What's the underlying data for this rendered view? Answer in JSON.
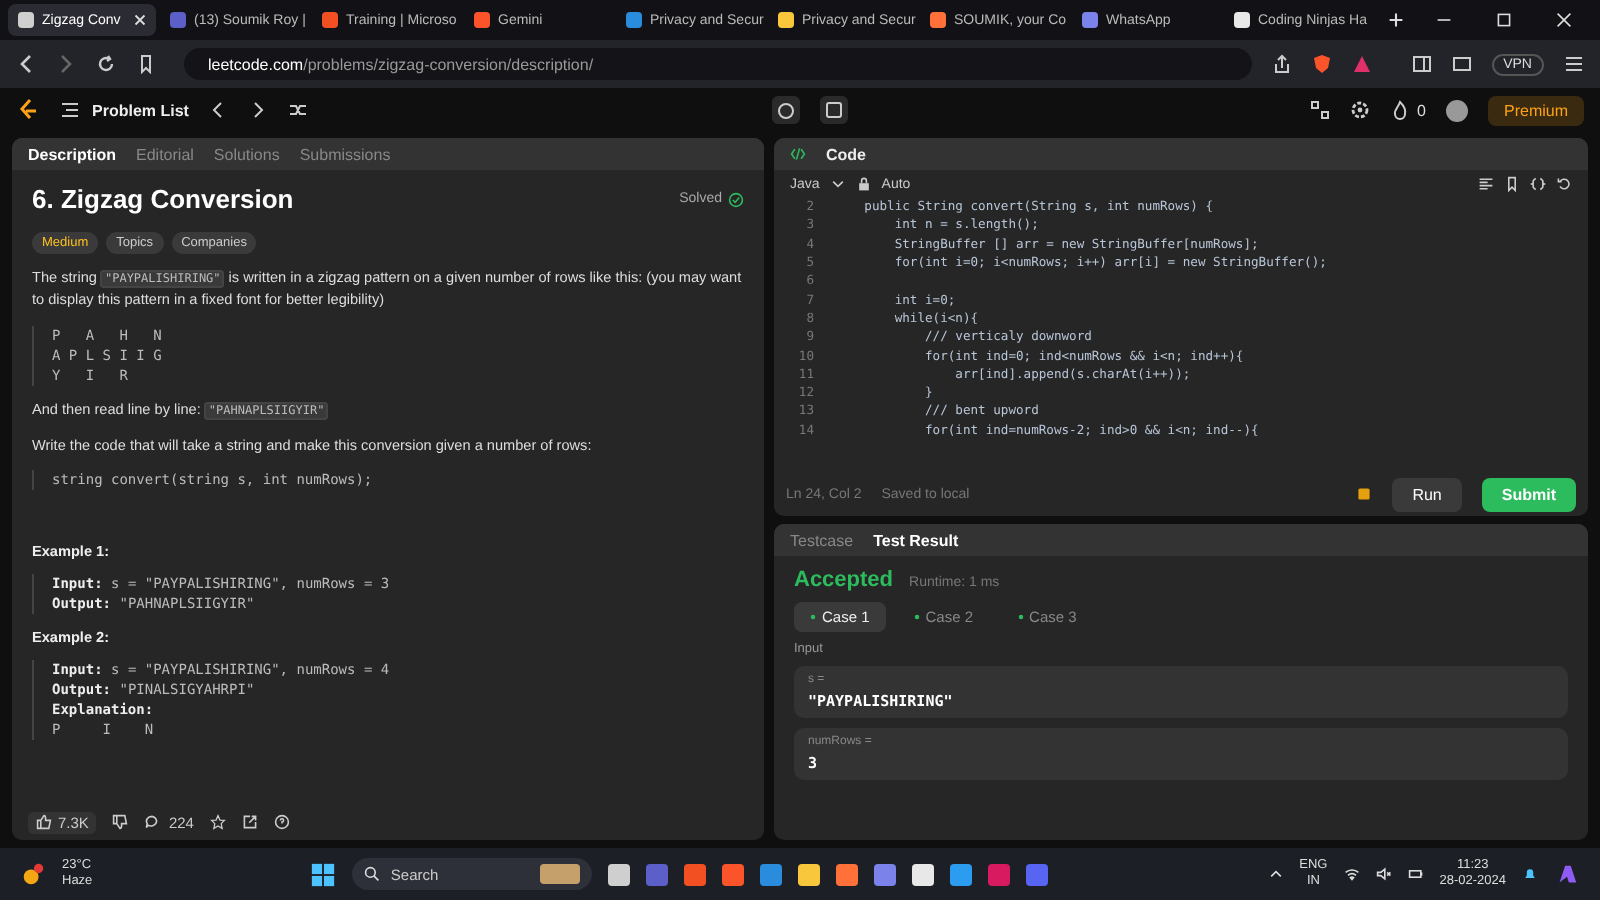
{
  "browser": {
    "tabs": [
      {
        "title": "Zigzag Conv",
        "selected": true
      },
      {
        "title": "(13) Soumik Roy |",
        "selected": false
      },
      {
        "title": "Training | Microso",
        "selected": false
      },
      {
        "title": "Gemini",
        "selected": false
      },
      {
        "title": "Privacy and Secur",
        "selected": false
      },
      {
        "title": "Privacy and Secur",
        "selected": false
      },
      {
        "title": "SOUMIK, your Co",
        "selected": false
      },
      {
        "title": "WhatsApp",
        "selected": false
      },
      {
        "title": "Coding Ninjas Ha",
        "selected": false
      }
    ],
    "address": {
      "domain": "leetcode.com",
      "path": "/problems/zigzag-conversion/description/"
    },
    "vpn": "VPN"
  },
  "header": {
    "problem_list": "Problem List",
    "streak": "0",
    "premium": "Premium"
  },
  "left_tabs": [
    {
      "label": "Description",
      "selected": true
    },
    {
      "label": "Editorial",
      "selected": false
    },
    {
      "label": "Solutions",
      "selected": false
    },
    {
      "label": "Submissions",
      "selected": false
    }
  ],
  "problem": {
    "title": "6. Zigzag Conversion",
    "status": "Solved",
    "difficulty": "Medium",
    "tags": [
      "Topics",
      "Companies"
    ],
    "intro": [
      {
        "kind": "text",
        "text": "The string "
      },
      {
        "kind": "code",
        "text": "\"PAYPALISHIRING\""
      },
      {
        "kind": "text",
        "text": " is written in a zigzag pattern on a given number of rows like this: (you may want to display this pattern in a fixed font for better legibility)"
      }
    ],
    "pattern": [
      "P   A   H   N",
      "A P L S I I G",
      "Y   I   R"
    ],
    "readline": [
      {
        "kind": "text",
        "text": "And then read line by line: "
      },
      {
        "kind": "code",
        "text": "\"PAHNAPLSIIGYIR\""
      }
    ],
    "task": "Write the code that will take a string and make this conversion given a number of rows:",
    "signature": "string convert(string s, int numRows);",
    "examples": [
      {
        "title": "Example 1:",
        "lines": [
          {
            "label": "Input:",
            "value": " s = \"PAYPALISHIRING\", numRows = 3"
          },
          {
            "label": "Output:",
            "value": " \"PAHNAPLSIIGYIR\""
          }
        ]
      },
      {
        "title": "Example 2:",
        "lines": [
          {
            "label": "Input:",
            "value": " s = \"PAYPALISHIRING\", numRows = 4"
          },
          {
            "label": "Output:",
            "value": " \"PINALSIGYAHRPI\""
          },
          {
            "label": "Explanation:"
          }
        ],
        "extra": [
          "P     I    N"
        ]
      }
    ],
    "likes": "7.3K",
    "comments": "224"
  },
  "code": {
    "title": "Code",
    "language": "Java",
    "mode": "Auto",
    "lines": [
      {
        "no": "2",
        "text": "    public String convert(String s, int numRows) {"
      },
      {
        "no": "3",
        "text": "        int n = s.length();"
      },
      {
        "no": "4",
        "text": "        StringBuffer [] arr = new StringBuffer[numRows];"
      },
      {
        "no": "5",
        "text": "        for(int i=0; i<numRows; i++) arr[i] = new StringBuffer();"
      },
      {
        "no": "6"
      },
      {
        "no": "7",
        "text": "        int i=0;"
      },
      {
        "no": "8",
        "text": "        while(i<n){"
      },
      {
        "no": "9",
        "text": "            /// verticaly downword"
      },
      {
        "no": "10",
        "text": "            for(int ind=0; ind<numRows && i<n; ind++){"
      },
      {
        "no": "11",
        "text": "                arr[ind].append(s.charAt(i++));"
      },
      {
        "no": "12",
        "text": "            }"
      },
      {
        "no": "13",
        "text": "            /// bent upword"
      },
      {
        "no": "14",
        "text": "            for(int ind=numRows-2; ind>0 && i<n; ind--){"
      }
    ],
    "position": "Ln 24, Col 2",
    "saved": "Saved to local",
    "run": "Run",
    "submit": "Submit"
  },
  "result": {
    "tabs": [
      {
        "label": "Testcase",
        "selected": false
      },
      {
        "label": "Test Result",
        "selected": true
      }
    ],
    "verdict": "Accepted",
    "runtime": "Runtime: 1 ms",
    "cases": [
      {
        "label": "Case 1",
        "selected": true
      },
      {
        "label": "Case 2",
        "selected": false
      },
      {
        "label": "Case 3",
        "selected": false
      }
    ],
    "input_label": "Input",
    "params": [
      {
        "name": "s =",
        "value": "\"PAYPALISHIRING\""
      },
      {
        "name": "numRows =",
        "value": "3"
      }
    ]
  },
  "taskbar": {
    "temperature": "23°C",
    "weather": "Haze",
    "search": "Search",
    "lang": "ENG",
    "region": "IN",
    "time": "11:23",
    "date": "28-02-2024"
  }
}
